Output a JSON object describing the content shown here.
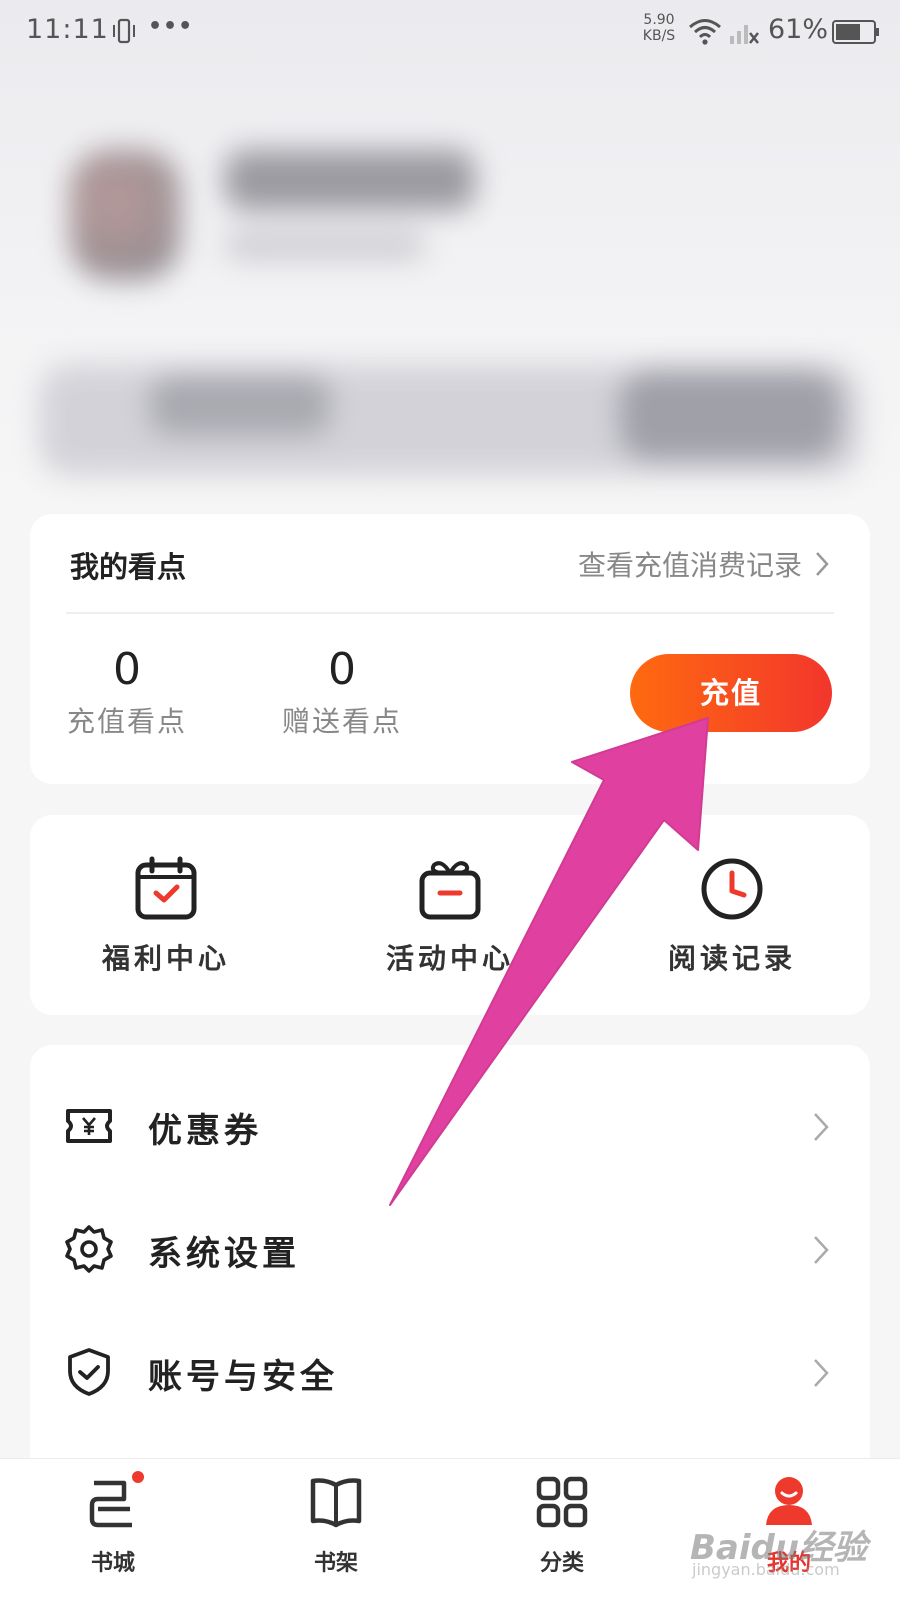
{
  "status_bar": {
    "time": "11:11",
    "dots": "•••",
    "net_speed_value": "5.90",
    "net_speed_unit": "KB/S",
    "battery_percent": "61%"
  },
  "points_card": {
    "title": "我的看点",
    "records_link": "查看充值消费记录",
    "recharge_points_value": "0",
    "recharge_points_label": "充值看点",
    "gift_points_value": "0",
    "gift_points_label": "赠送看点",
    "recharge_button": "充值"
  },
  "quick_actions": [
    {
      "label": "福利中心",
      "icon": "calendar-check-icon"
    },
    {
      "label": "活动中心",
      "icon": "gift-box-icon"
    },
    {
      "label": "阅读记录",
      "icon": "clock-icon"
    }
  ],
  "menu": [
    {
      "label": "优惠券",
      "icon": "coupon-yen-icon"
    },
    {
      "label": "系统设置",
      "icon": "gear-icon"
    },
    {
      "label": "账号与安全",
      "icon": "shield-check-icon"
    }
  ],
  "bottom_nav": [
    {
      "label": "书城",
      "icon": "bookstore-icon",
      "badge": true
    },
    {
      "label": "书架",
      "icon": "open-book-icon"
    },
    {
      "label": "分类",
      "icon": "grid-icon"
    },
    {
      "label": "我的",
      "icon": "person-icon",
      "active": true
    }
  ],
  "colors": {
    "accent_start": "#ff6a10",
    "accent_end": "#f2362c",
    "active_nav": "#e8332c",
    "annotation_arrow": "#e0409f"
  },
  "watermark": {
    "text": "Baidu经验",
    "url": "jingyan.baidu.com"
  }
}
